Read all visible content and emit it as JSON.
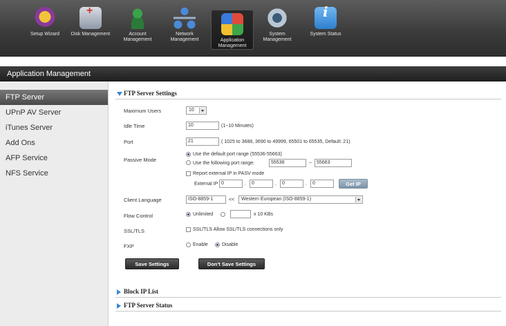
{
  "toolbar": {
    "items": [
      {
        "label": "Setup Wizard",
        "icon": "setup-wizard-icon"
      },
      {
        "label": "Disk Management",
        "icon": "disk-icon"
      },
      {
        "label": "Account Management",
        "icon": "account-icon"
      },
      {
        "label": "Network Management",
        "icon": "network-icon"
      },
      {
        "label": "Application Management",
        "icon": "application-icon"
      },
      {
        "label": "System Management",
        "icon": "system-icon"
      },
      {
        "label": "System Status",
        "icon": "status-icon"
      }
    ]
  },
  "section_title": "Application Management",
  "sidebar": {
    "items": [
      {
        "label": "FTP Server"
      },
      {
        "label": "UPnP AV Server"
      },
      {
        "label": "iTunes Server"
      },
      {
        "label": "Add Ons"
      },
      {
        "label": "AFP Service"
      },
      {
        "label": "NFS Service"
      }
    ]
  },
  "ftp": {
    "title": "FTP Server Settings",
    "max_users_label": "Maximum Users",
    "max_users_value": "10",
    "idle_time_label": "Idle Time",
    "idle_time_value": "10",
    "idle_time_hint": "(1~10 Minutes)",
    "port_label": "Port",
    "port_value": "21",
    "port_hint": "( 1025 to 3688, 3690 to 49999, 65501 to 65535, Default: 21)",
    "passive_label": "Passive Mode",
    "passive_default": "Use the default port range (55536-55663)",
    "passive_custom": "Use the following port range:",
    "passive_start": "55536",
    "passive_sep": "~",
    "passive_end": "55663",
    "report_external": "Report external IP in PASV mode",
    "external_ip_label": "External IP :",
    "ip": [
      "0",
      "0",
      "0",
      "0"
    ],
    "get_ip_button": "Get IP",
    "client_lang_label": "Client Language",
    "client_lang_value": "ISO-8859-1",
    "client_lang_arrows": "<<",
    "client_lang_select": "Western European (ISO-8859-1)",
    "flow_label": "Flow Control",
    "flow_unlimited": "Unlimited",
    "flow_unit": "x 10 KBs",
    "ssl_label": "SSL/TLS",
    "ssl_option": "SSL/TLS Allow SSL/TLS connections only",
    "fxp_label": "FXP",
    "fxp_enable": "Enable",
    "fxp_disable": "Disable",
    "save_button": "Save Settings",
    "dont_save_button": "Don't Save Settings"
  },
  "block_ip_title": "Block IP List",
  "ftp_status_title": "FTP Server Status"
}
